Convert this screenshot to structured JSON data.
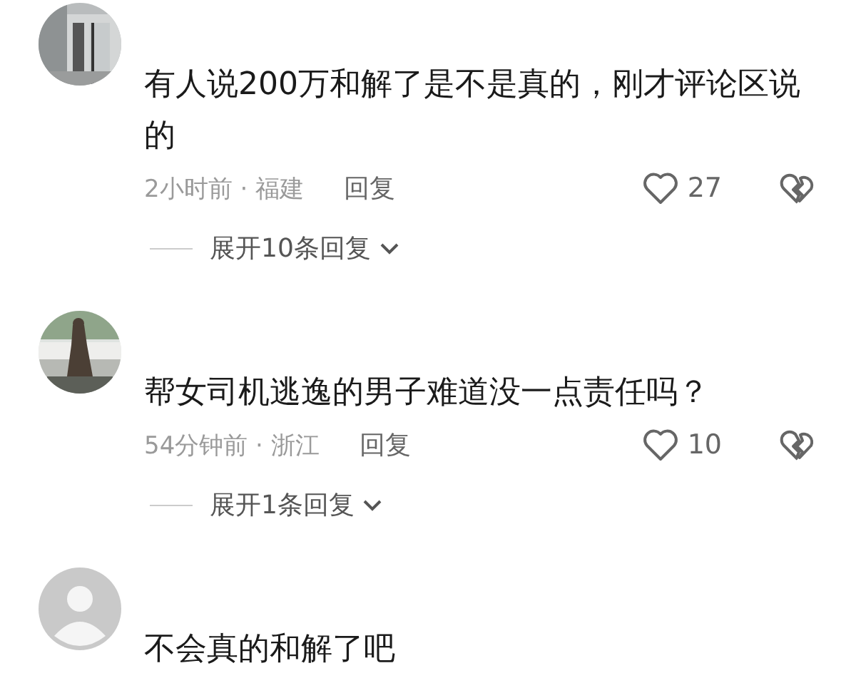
{
  "comments": [
    {
      "text": "有人说200万和解了是不是真的，刚才评论区说的",
      "meta": "2小时前 · 福建",
      "reply": "回复",
      "likes": "27",
      "replies_toggle": "展开10条回复"
    },
    {
      "text": "帮女司机逃逸的男子难道没一点责任吗？",
      "meta": "54分钟前 · 浙江",
      "reply": "回复",
      "likes": "10",
      "replies_toggle": "展开1条回复"
    },
    {
      "avatar": {
        "kind": "default"
      },
      "text": "不会真的和解了吧"
    }
  ]
}
